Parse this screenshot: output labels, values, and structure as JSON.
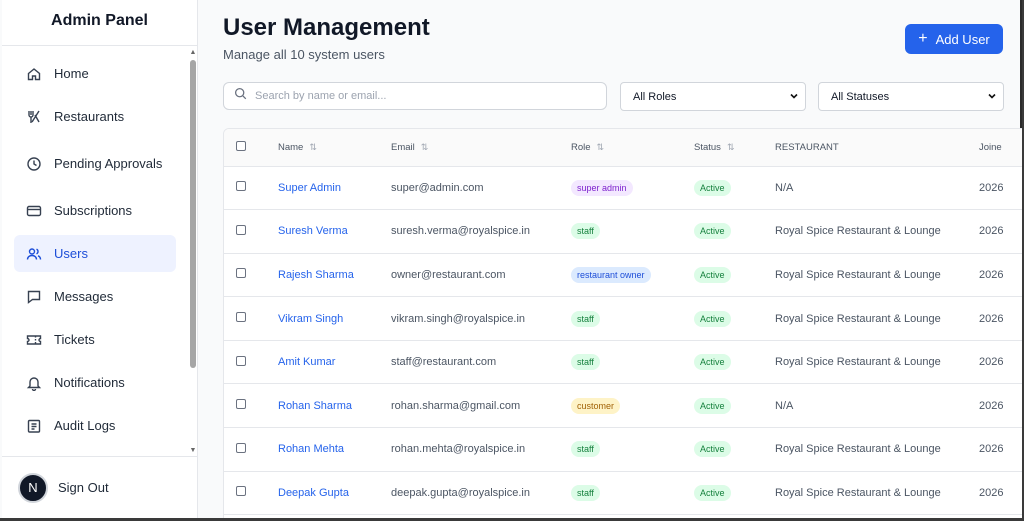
{
  "sidebar": {
    "title": "Admin Panel",
    "items": [
      {
        "label": "Home",
        "icon": "home-icon"
      },
      {
        "label": "Restaurants",
        "icon": "utensils-icon"
      },
      {
        "label": "Pending Approvals",
        "icon": "clock-icon"
      },
      {
        "label": "Subscriptions",
        "icon": "credit-card-icon"
      },
      {
        "label": "Users",
        "icon": "users-icon",
        "active": true
      },
      {
        "label": "Messages",
        "icon": "message-icon"
      },
      {
        "label": "Tickets",
        "icon": "ticket-icon"
      },
      {
        "label": "Notifications",
        "icon": "bell-icon"
      },
      {
        "label": "Audit Logs",
        "icon": "clipboard-icon"
      }
    ],
    "footer": {
      "avatar_initial": "N",
      "signout_label": "Sign Out"
    }
  },
  "header": {
    "title": "User Management",
    "subtitle": "Manage all 10 system users",
    "add_button_label": "Add User"
  },
  "filters": {
    "search_placeholder": "Search by name or email...",
    "roles_selected": "All Roles",
    "status_selected": "All Statuses"
  },
  "table": {
    "columns": [
      "Name",
      "Email",
      "Role",
      "Status",
      "RESTAURANT",
      "Joine"
    ],
    "rows": [
      {
        "name": "Super Admin",
        "email": "super@admin.com",
        "role": "super admin",
        "role_kind": "super",
        "status": "Active",
        "restaurant": "N/A",
        "joined": "2026"
      },
      {
        "name": "Suresh Verma",
        "email": "suresh.verma@royalspice.in",
        "role": "staff",
        "role_kind": "staff",
        "status": "Active",
        "restaurant": "Royal Spice Restaurant & Lounge",
        "joined": "2026"
      },
      {
        "name": "Rajesh Sharma",
        "email": "owner@restaurant.com",
        "role": "restaurant owner",
        "role_kind": "owner",
        "status": "Active",
        "restaurant": "Royal Spice Restaurant & Lounge",
        "joined": "2026"
      },
      {
        "name": "Vikram Singh",
        "email": "vikram.singh@royalspice.in",
        "role": "staff",
        "role_kind": "staff",
        "status": "Active",
        "restaurant": "Royal Spice Restaurant & Lounge",
        "joined": "2026"
      },
      {
        "name": "Amit Kumar",
        "email": "staff@restaurant.com",
        "role": "staff",
        "role_kind": "staff",
        "status": "Active",
        "restaurant": "Royal Spice Restaurant & Lounge",
        "joined": "2026"
      },
      {
        "name": "Rohan Sharma",
        "email": "rohan.sharma@gmail.com",
        "role": "customer",
        "role_kind": "customer",
        "status": "Active",
        "restaurant": "N/A",
        "joined": "2026"
      },
      {
        "name": "Rohan Mehta",
        "email": "rohan.mehta@royalspice.in",
        "role": "staff",
        "role_kind": "staff",
        "status": "Active",
        "restaurant": "Royal Spice Restaurant & Lounge",
        "joined": "2026"
      },
      {
        "name": "Deepak Gupta",
        "email": "deepak.gupta@royalspice.in",
        "role": "staff",
        "role_kind": "staff",
        "status": "Active",
        "restaurant": "Royal Spice Restaurant & Lounge",
        "joined": "2026"
      }
    ]
  },
  "colors": {
    "accent": "#2563eb",
    "active_nav_bg": "#eef2ff",
    "status_active": "#15803d"
  }
}
